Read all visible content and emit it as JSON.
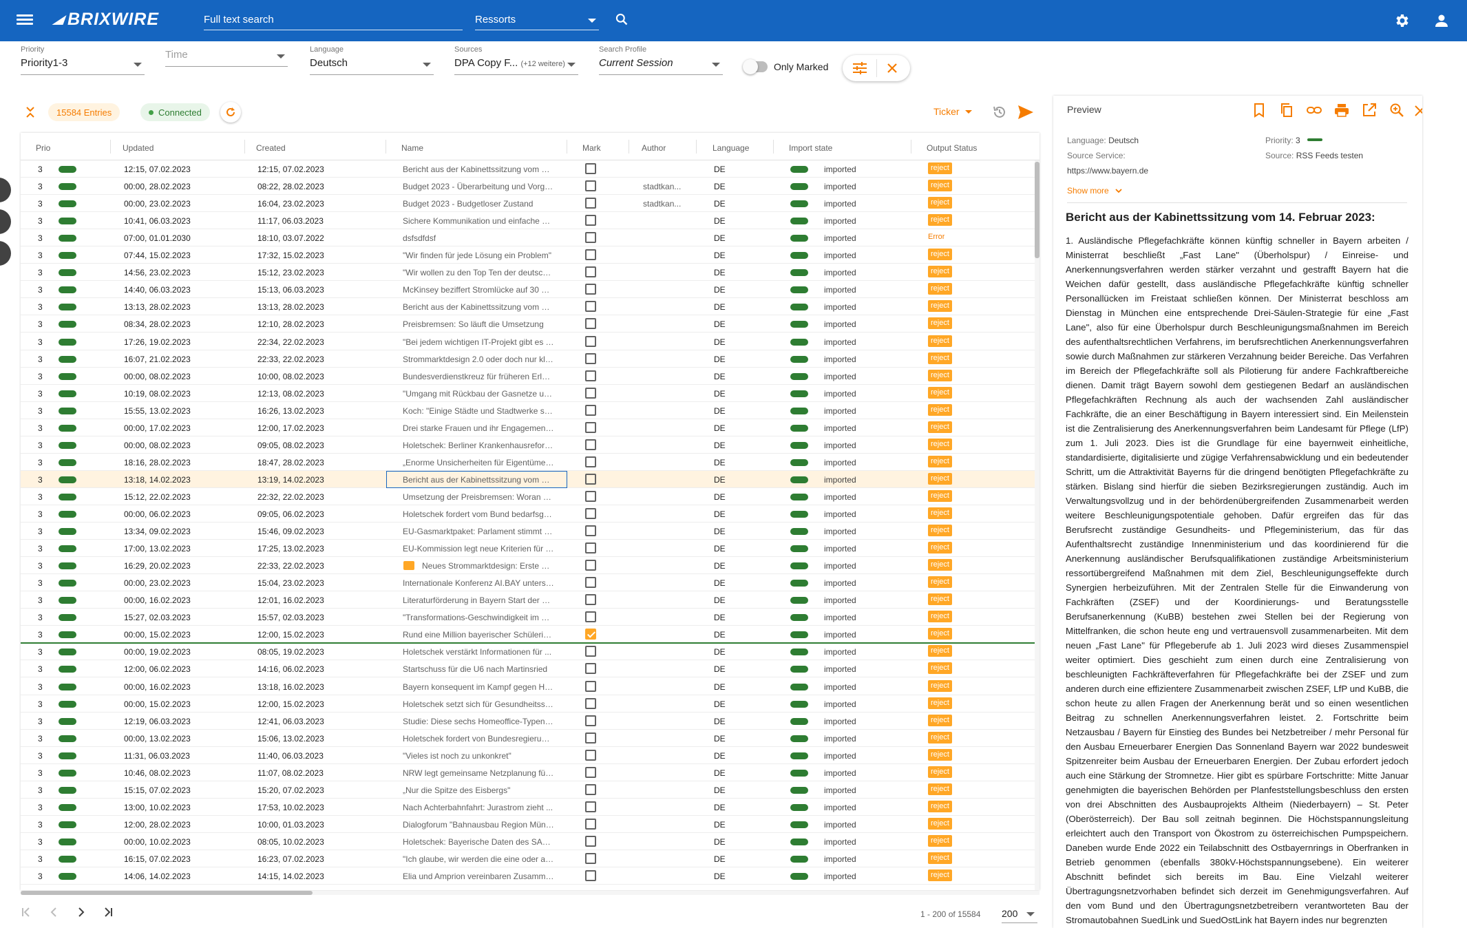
{
  "app": {
    "name": "BRIXWIRE",
    "search_placeholder": "Full text search",
    "ressorts": "Ressorts"
  },
  "filters": [
    {
      "label": "Priority",
      "value": "Priority1-3",
      "placeholder": false
    },
    {
      "label": "",
      "value": "Time",
      "placeholder": true
    },
    {
      "label": "Language",
      "value": "Deutsch",
      "placeholder": false
    },
    {
      "label": "Sources",
      "value": "DPA Copy F...",
      "extra": "(+12 weitere)",
      "placeholder": false
    },
    {
      "label": "Search Profile",
      "value": "Current Session",
      "placeholder": false
    }
  ],
  "only_marked": "Only Marked",
  "toolbar": {
    "entries": "15584 Entries",
    "status": "Connected",
    "ticker": "Ticker"
  },
  "columns": [
    "Prio",
    "Updated",
    "Created",
    "Name",
    "Mark",
    "Author",
    "Language",
    "Import state",
    "Output Status"
  ],
  "rows": [
    {
      "p": "3",
      "u": "12:15, 07.02.2023",
      "c": "12:15, 07.02.2023",
      "n": "Bericht aus der Kabinettssitzung vom 7. ...",
      "m": false,
      "a": "",
      "l": "DE",
      "i": "imported",
      "o": "reject"
    },
    {
      "p": "3",
      "u": "00:00, 28.02.2023",
      "c": "08:22, 28.02.2023",
      "n": "Budget 2023 - Überarbeitung und Vorge...",
      "m": false,
      "a": "stadtkan...",
      "l": "DE",
      "i": "imported",
      "o": "reject"
    },
    {
      "p": "3",
      "u": "00:00, 23.02.2023",
      "c": "16:04, 23.02.2023",
      "n": "Budget 2023 - Budgetloser Zustand",
      "m": false,
      "a": "stadtkan...",
      "l": "DE",
      "i": "imported",
      "o": "reject"
    },
    {
      "p": "3",
      "u": "10:41, 06.03.2023",
      "c": "11:17, 06.03.2023",
      "n": "Sichere Kommunikation und einfache Er...",
      "m": false,
      "a": "",
      "l": "DE",
      "i": "imported",
      "o": "reject"
    },
    {
      "p": "3",
      "u": "07:00, 01.01.2030",
      "c": "18:10, 03.07.2022",
      "n": "dsfsdfdsf",
      "m": false,
      "a": "",
      "l": "DE",
      "i": "imported",
      "o": "Error"
    },
    {
      "p": "3",
      "u": "07:44, 15.02.2023",
      "c": "17:32, 15.02.2023",
      "n": "\"Wir finden für jede Lösung ein Problem\"",
      "m": false,
      "a": "",
      "l": "DE",
      "i": "imported",
      "o": "reject"
    },
    {
      "p": "3",
      "u": "14:56, 23.02.2023",
      "c": "15:12, 23.02.2023",
      "n": "\"Wir wollen zu den Top Ten der deutsche...",
      "m": false,
      "a": "",
      "l": "DE",
      "i": "imported",
      "o": "reject"
    },
    {
      "p": "3",
      "u": "14:40, 06.03.2023",
      "c": "15:13, 06.03.2023",
      "n": "McKinsey beziffert Stromlücke auf 30 GW",
      "m": false,
      "a": "",
      "l": "DE",
      "i": "imported",
      "o": "reject"
    },
    {
      "p": "3",
      "u": "13:13, 28.02.2023",
      "c": "13:13, 28.02.2023",
      "n": "Bericht aus der Kabinettssitzung vom 28...",
      "m": false,
      "a": "",
      "l": "DE",
      "i": "imported",
      "o": "reject"
    },
    {
      "p": "3",
      "u": "08:34, 28.02.2023",
      "c": "12:10, 28.02.2023",
      "n": "Preisbremsen: So läuft die Umsetzung",
      "m": false,
      "a": "",
      "l": "DE",
      "i": "imported",
      "o": "reject"
    },
    {
      "p": "3",
      "u": "17:26, 19.02.2023",
      "c": "22:34, 22.02.2023",
      "n": "\"Bei jedem wichtigen IT-Projekt gibt es T...",
      "m": false,
      "a": "",
      "l": "DE",
      "i": "imported",
      "o": "reject"
    },
    {
      "p": "3",
      "u": "16:07, 21.02.2023",
      "c": "22:33, 22.02.2023",
      "n": "Strommarktdesign 2.0 oder doch nur kle...",
      "m": false,
      "a": "",
      "l": "DE",
      "i": "imported",
      "o": "reject"
    },
    {
      "p": "3",
      "u": "00:00, 08.02.2023",
      "c": "10:00, 08.02.2023",
      "n": "Bundesverdienstkreuz für früheren Erlan...",
      "m": false,
      "a": "",
      "l": "DE",
      "i": "imported",
      "o": "reject"
    },
    {
      "p": "3",
      "u": "10:19, 08.02.2023",
      "c": "12:13, 08.02.2023",
      "n": "\"Umgang mit Rückbau der Gasnetze und...",
      "m": false,
      "a": "",
      "l": "DE",
      "i": "imported",
      "o": "reject"
    },
    {
      "p": "3",
      "u": "15:55, 13.02.2023",
      "c": "16:26, 13.02.2023",
      "n": "Koch: \"Einige Städte und Stadtwerke sto...",
      "m": false,
      "a": "",
      "l": "DE",
      "i": "imported",
      "o": "reject"
    },
    {
      "p": "3",
      "u": "00:00, 17.02.2023",
      "c": "12:00, 17.02.2023",
      "n": "Drei starke Frauen und ihr Engagement ...",
      "m": false,
      "a": "",
      "l": "DE",
      "i": "imported",
      "o": "reject"
    },
    {
      "p": "3",
      "u": "00:00, 08.02.2023",
      "c": "09:05, 08.02.2023",
      "n": "Holetschek: Berliner Krankenhausreform...",
      "m": false,
      "a": "",
      "l": "DE",
      "i": "imported",
      "o": "reject"
    },
    {
      "p": "3",
      "u": "18:16, 28.02.2023",
      "c": "18:47, 28.02.2023",
      "n": "„Enorme Unsicherheiten für Eigentümer ...",
      "m": false,
      "a": "",
      "l": "DE",
      "i": "imported",
      "o": "reject"
    },
    {
      "p": "3",
      "u": "13:18, 14.02.2023",
      "c": "13:19, 14.02.2023",
      "n": "Bericht aus der Kabinettssitzung vom 14...",
      "m": false,
      "a": "",
      "l": "DE",
      "i": "imported",
      "o": "reject",
      "hl": true
    },
    {
      "p": "3",
      "u": "15:12, 22.02.2023",
      "c": "22:32, 22.02.2023",
      "n": "Umsetzung der Preisbremsen: Woran es...",
      "m": false,
      "a": "",
      "l": "DE",
      "i": "imported",
      "o": "reject"
    },
    {
      "p": "3",
      "u": "00:00, 06.02.2023",
      "c": "09:05, 06.02.2023",
      "n": "Holetschek fordert vom Bund bedarfsge...",
      "m": false,
      "a": "",
      "l": "DE",
      "i": "imported",
      "o": "reject"
    },
    {
      "p": "3",
      "u": "13:34, 09.02.2023",
      "c": "15:46, 09.02.2023",
      "n": "EU-Gasmarktpaket: Parlament stimmt g...",
      "m": false,
      "a": "",
      "l": "DE",
      "i": "imported",
      "o": "reject"
    },
    {
      "p": "3",
      "u": "17:00, 13.02.2023",
      "c": "17:25, 13.02.2023",
      "n": "EU-Kommission legt neue Kriterien für g...",
      "m": false,
      "a": "",
      "l": "DE",
      "i": "imported",
      "o": "reject"
    },
    {
      "p": "3",
      "u": "16:29, 20.02.2023",
      "c": "22:33, 22.02.2023",
      "n": "Neues Strommarktdesign: Erste Er...",
      "m": false,
      "a": "",
      "l": "DE",
      "i": "imported",
      "o": "reject",
      "icon": true
    },
    {
      "p": "3",
      "u": "00:00, 23.02.2023",
      "c": "15:04, 23.02.2023",
      "n": "Internationale Konferenz AI.BAY unterstr...",
      "m": false,
      "a": "",
      "l": "DE",
      "i": "imported",
      "o": "reject"
    },
    {
      "p": "3",
      "u": "00:00, 16.02.2023",
      "c": "12:01, 16.02.2023",
      "n": "Literaturförderung in Bayern Start der ne...",
      "m": false,
      "a": "",
      "l": "DE",
      "i": "imported",
      "o": "reject"
    },
    {
      "p": "3",
      "u": "15:27, 02.03.2023",
      "c": "15:57, 02.03.2023",
      "n": "\"Transformations-Geschwindigkeit im W...",
      "m": false,
      "a": "",
      "l": "DE",
      "i": "imported",
      "o": "reject"
    },
    {
      "p": "3",
      "u": "00:00, 15.02.2023",
      "c": "12:00, 15.02.2023",
      "n": "Rund eine Million bayerischer Schülerinn...",
      "m": true,
      "a": "",
      "l": "DE",
      "i": "imported",
      "o": "reject"
    },
    {
      "p": "3",
      "u": "00:00, 19.02.2023",
      "c": "08:05, 19.02.2023",
      "n": "Holetschek verstärkt Informationen für ...",
      "m": false,
      "a": "",
      "l": "DE",
      "i": "imported",
      "o": "reject"
    },
    {
      "p": "3",
      "u": "12:00, 06.02.2023",
      "c": "14:16, 06.02.2023",
      "n": "Startschuss für die U6 nach Martinsried",
      "m": false,
      "a": "",
      "l": "DE",
      "i": "imported",
      "o": "reject"
    },
    {
      "p": "3",
      "u": "00:00, 16.02.2023",
      "c": "13:18, 16.02.2023",
      "n": "Bayern konsequent im Kampf gegen Ha...",
      "m": false,
      "a": "",
      "l": "DE",
      "i": "imported",
      "o": "reject"
    },
    {
      "p": "3",
      "u": "00:00, 15.02.2023",
      "c": "12:00, 15.02.2023",
      "n": "Holetschek setzt sich für Gesundheitssc...",
      "m": false,
      "a": "",
      "l": "DE",
      "i": "imported",
      "o": "reject"
    },
    {
      "p": "3",
      "u": "12:19, 06.03.2023",
      "c": "12:41, 06.03.2023",
      "n": "Studie: Diese sechs Homeoffice-Typen g...",
      "m": false,
      "a": "",
      "l": "DE",
      "i": "imported",
      "o": "reject"
    },
    {
      "p": "3",
      "u": "00:00, 13.02.2023",
      "c": "15:06, 13.02.2023",
      "n": "Holetschek fordert von Bundesregierung...",
      "m": false,
      "a": "",
      "l": "DE",
      "i": "imported",
      "o": "reject"
    },
    {
      "p": "3",
      "u": "11:31, 06.03.2023",
      "c": "11:40, 06.03.2023",
      "n": "\"Vieles ist noch zu unkonkret\"",
      "m": false,
      "a": "",
      "l": "DE",
      "i": "imported",
      "o": "reject"
    },
    {
      "p": "3",
      "u": "10:46, 08.02.2023",
      "c": "11:07, 08.02.2023",
      "n": "NRW legt gemeinsame Netzplanung für ...",
      "m": false,
      "a": "",
      "l": "DE",
      "i": "imported",
      "o": "reject"
    },
    {
      "p": "3",
      "u": "15:15, 07.02.2023",
      "c": "15:20, 07.02.2023",
      "n": "„Nur die Spitze des Eisbergs\"",
      "m": false,
      "a": "",
      "l": "DE",
      "i": "imported",
      "o": "reject"
    },
    {
      "p": "3",
      "u": "13:00, 10.02.2023",
      "c": "17:53, 10.02.2023",
      "n": "Nach Achterbahnfahrt: Jurastrom zieht ...",
      "m": false,
      "a": "",
      "l": "DE",
      "i": "imported",
      "o": "reject"
    },
    {
      "p": "3",
      "u": "12:00, 28.02.2023",
      "c": "10:00, 01.03.2023",
      "n": "Dialogforum \"Bahnausbau Region Münc...",
      "m": false,
      "a": "",
      "l": "DE",
      "i": "imported",
      "o": "reject"
    },
    {
      "p": "3",
      "u": "00:00, 10.02.2023",
      "c": "08:05, 10.02.2023",
      "n": "Holetschek: Bayerische Daten des SARS...",
      "m": false,
      "a": "",
      "l": "DE",
      "i": "imported",
      "o": "reject"
    },
    {
      "p": "3",
      "u": "16:15, 07.02.2023",
      "c": "16:23, 07.02.2023",
      "n": "\"Ich glaube, wir werden die eine oder an...",
      "m": false,
      "a": "",
      "l": "DE",
      "i": "imported",
      "o": "reject"
    },
    {
      "p": "3",
      "u": "14:06, 14.02.2023",
      "c": "14:15, 14.02.2023",
      "n": "Elia und Amprion vereinbaren Zusamme...",
      "m": false,
      "a": "",
      "l": "DE",
      "i": "imported",
      "o": "reject"
    }
  ],
  "pagination": {
    "info": "1 - 200 of 15584",
    "size": "200"
  },
  "preview": {
    "title": "Preview",
    "language_label": "Language:",
    "language": "Deutsch",
    "priority_label": "Priority:",
    "priority": "3",
    "service_label": "Source Service:",
    "service": "https://www.bayern.de",
    "source_label": "Source:",
    "source": "RSS Feeds testen",
    "show_more": "Show more",
    "heading": "Bericht aus der Kabinettssitzung vom 14. Februar 2023:",
    "body": "1. Ausländische Pflegefachkräfte können künftig schneller in Bayern arbeiten / Ministerrat beschließt „Fast Lane\" (Überholspur) / Einreise- und Anerkennungsverfahren werden stärker verzahnt und gestrafft Bayern hat die Weichen dafür gestellt, dass ausländische Pflegefachkräfte künftig schneller Personallücken im Freistaat schließen können. Der Ministerrat beschloss am Dienstag in München eine entsprechende Drei-Säulen-Strategie für eine „Fast Lane\", also für eine Überholspur durch Beschleunigungsmaßnahmen im Bereich des aufenthaltsrechtlichen Verfahrens, im berufsrechtlichen Anerkennungsverfahren sowie durch Maßnahmen zur stärkeren Verzahnung beider Bereiche. Das Verfahren im Bereich der Pflegefachkräfte soll als Pilotierung für andere Fachkraftbereiche dienen. Damit trägt Bayern sowohl dem gestiegenen Bedarf an ausländischen Pflegefachkräften Rechnung als auch der wachsenden Zahl ausländischer Fachkräfte, die an einer Beschäftigung in Bayern interessiert sind. Ein Meilenstein ist die Zentralisierung des Anerkennungsverfahren beim Landesamt für Pflege (LfP) zum 1. Juli 2023. Dies ist die Grundlage für eine bayernweit einheitliche, standardisierte, digitalisierte und zügige Verfahrensabwicklung und ein bedeutender Schritt, um die Attraktivität Bayerns für die dringend benötigten Pflegefachkräfte zu stärken. Bislang sind hierfür die sieben Bezirksregierungen zuständig. Auch im Verwaltungsvollzug und in der behördenübergreifenden Zusammenarbeit werden weitere Beschleunigungspotentiale gehoben. Dafür ergreifen das für das Berufsrecht zuständige Gesundheits- und Pflegeministerium, das für das Aufenthaltsrecht zuständige Innenministerium und das koordinierend für die Anerkennung ausländischer Berufsqualifikationen zuständige Arbeitsministerium ressortübergreifend Maßnahmen mit dem Ziel, Beschleunigungseffekte durch Synergien herbeizuführen. Mit der Zentralen Stelle für die Einwanderung von Fachkräften (ZSEF) und der Koordinierungs- und Beratungsstelle Berufsanerkennung (KuBB) bestehen zwei Stellen bei der Regierung von Mittelfranken, die schon heute eng und vertrauensvoll zusammenarbeiten. Mit dem neuen „Fast Lane\" für Pflegeberufe ab 1. Juli 2023 wird dieses Zusammenspiel weiter optimiert. Dies geschieht zum einen durch eine Zentralisierung von beschleunigten Fachkräfteverfahren für Pflegefachkräfte bei der ZSEF und zum anderen durch eine effizientere Zusammenarbeit zwischen ZSEF, LfP und KuBB, die schon heute zu allen Fragen der Anerkennung berät und so einen wesentlichen Beitrag zu schnellen Anerkennungsverfahren leistet. 2. Fortschritte beim Netzausbau / Bayern für Einstieg des Bundes bei Netzbetreiber / mehr Personal für den Ausbau Erneuerbarer Energien Das Sonnenland Bayern war 2022 bundesweit Spitzenreiter beim Ausbau der Erneuerbaren Energien. Der Zubau erfordert jedoch auch eine Stärkung der Stromnetze. Hier gibt es spürbare Fortschritte: Mitte Januar genehmigten die bayerischen Behörden per Planfeststellungsbeschluss den ersten von drei Abschnitten des Ausbauprojekts Altheim (Niederbayern) – St. Peter (Oberösterreich). Der Bau soll zeitnah beginnen. Die Höchstspannungsleitung erleichtert auch den Transport von Ökostrom zu österreichischen Pumpspeichern. Daneben wurde Ende 2022 ein Teilabschnitt des Ostbayernrings in Oberfranken in Betrieb genommen (ebenfalls 380kV-Höchstspannungsebene). Ein weiterer Abschnitt befindet sich bereits im Bau. Eine Vielzahl weiterer Übertragungsnetzvorhaben befindet sich derzeit im Genehmigungsverfahren. Auf den vom Bund und den Übertragungsnetzbetreibern verantworteten Bau der Stromautobahnen SuedLink und SuedOstLink hat Bayern indes nur begrenzten"
  },
  "colors": {
    "primary": "#1565c0",
    "accent": "#ffa726",
    "green": "#2e7d32"
  }
}
